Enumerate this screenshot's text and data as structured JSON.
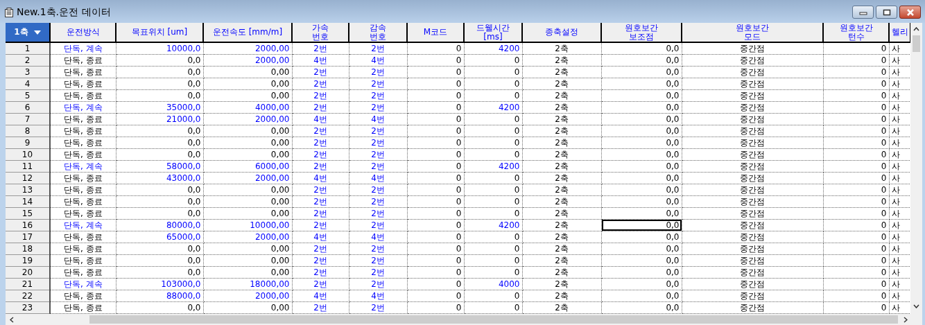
{
  "window": {
    "title": "New.1축.운전 데이터"
  },
  "axis_selector": {
    "value": "1축"
  },
  "columns": [
    "운전방식",
    "목표위치 [um]",
    "운전속도 [mm/m]",
    "가속\n번호",
    "감속\n번호",
    "M코드",
    "드웰시간\n[ms]",
    "종축설정",
    "원호보간\n보조점",
    "원호보간\n모드",
    "원호보간\n턴수",
    "헬리"
  ],
  "rows": [
    {
      "label": "1",
      "values": [
        "단독, 계속",
        "10000,0",
        "2000,00",
        "2번",
        "2번",
        "0",
        "4200",
        "2축",
        "0,0",
        "중간점",
        "0",
        "사"
      ],
      "blue": [
        true,
        true,
        true,
        true,
        true,
        false,
        true,
        false,
        false,
        false,
        false,
        false
      ],
      "selected": [
        false,
        false,
        false,
        false,
        false,
        false,
        false,
        false,
        false,
        false,
        false,
        false
      ]
    },
    {
      "label": "2",
      "values": [
        "단독, 종료",
        "0,0",
        "2000,00",
        "4번",
        "4번",
        "0",
        "0",
        "2축",
        "0,0",
        "중간점",
        "0",
        "사"
      ],
      "blue": [
        false,
        false,
        true,
        true,
        true,
        false,
        false,
        false,
        false,
        false,
        false,
        false
      ],
      "selected": [
        false,
        false,
        false,
        false,
        false,
        false,
        false,
        false,
        false,
        false,
        false,
        false
      ]
    },
    {
      "label": "3",
      "values": [
        "단독, 종료",
        "0,0",
        "0,00",
        "2번",
        "2번",
        "0",
        "0",
        "2축",
        "0,0",
        "중간점",
        "0",
        "사"
      ],
      "blue": [
        false,
        false,
        false,
        true,
        true,
        false,
        false,
        false,
        false,
        false,
        false,
        false
      ],
      "selected": [
        false,
        false,
        false,
        false,
        false,
        false,
        false,
        false,
        false,
        false,
        false,
        false
      ]
    },
    {
      "label": "4",
      "values": [
        "단독, 종료",
        "0,0",
        "0,00",
        "2번",
        "2번",
        "0",
        "0",
        "2축",
        "0,0",
        "중간점",
        "0",
        "사"
      ],
      "blue": [
        false,
        false,
        false,
        true,
        true,
        false,
        false,
        false,
        false,
        false,
        false,
        false
      ],
      "selected": [
        false,
        false,
        false,
        false,
        false,
        false,
        false,
        false,
        false,
        false,
        false,
        false
      ]
    },
    {
      "label": "5",
      "values": [
        "단독, 종료",
        "0,0",
        "0,00",
        "2번",
        "2번",
        "0",
        "0",
        "2축",
        "0,0",
        "중간점",
        "0",
        "사"
      ],
      "blue": [
        false,
        false,
        false,
        true,
        true,
        false,
        false,
        false,
        false,
        false,
        false,
        false
      ],
      "selected": [
        false,
        false,
        false,
        false,
        false,
        false,
        false,
        false,
        false,
        false,
        false,
        false
      ]
    },
    {
      "label": "6",
      "values": [
        "단독, 계속",
        "35000,0",
        "4000,00",
        "2번",
        "2번",
        "0",
        "4200",
        "2축",
        "0,0",
        "중간점",
        "0",
        "사"
      ],
      "blue": [
        true,
        true,
        true,
        true,
        true,
        false,
        true,
        false,
        false,
        false,
        false,
        false
      ],
      "selected": [
        false,
        false,
        false,
        false,
        false,
        false,
        false,
        false,
        false,
        false,
        false,
        false
      ]
    },
    {
      "label": "7",
      "values": [
        "단독, 종료",
        "21000,0",
        "2000,00",
        "4번",
        "4번",
        "0",
        "0",
        "2축",
        "0,0",
        "중간점",
        "0",
        "사"
      ],
      "blue": [
        false,
        true,
        true,
        true,
        true,
        false,
        false,
        false,
        false,
        false,
        false,
        false
      ],
      "selected": [
        false,
        false,
        false,
        false,
        false,
        false,
        false,
        false,
        false,
        false,
        false,
        false
      ]
    },
    {
      "label": "8",
      "values": [
        "단독, 종료",
        "0,0",
        "0,00",
        "2번",
        "2번",
        "0",
        "0",
        "2축",
        "0,0",
        "중간점",
        "0",
        "사"
      ],
      "blue": [
        false,
        false,
        false,
        true,
        true,
        false,
        false,
        false,
        false,
        false,
        false,
        false
      ],
      "selected": [
        false,
        false,
        false,
        false,
        false,
        false,
        false,
        false,
        false,
        false,
        false,
        false
      ]
    },
    {
      "label": "9",
      "values": [
        "단독, 종료",
        "0,0",
        "0,00",
        "2번",
        "2번",
        "0",
        "0",
        "2축",
        "0,0",
        "중간점",
        "0",
        "사"
      ],
      "blue": [
        false,
        false,
        false,
        true,
        true,
        false,
        false,
        false,
        false,
        false,
        false,
        false
      ],
      "selected": [
        false,
        false,
        false,
        false,
        false,
        false,
        false,
        false,
        false,
        false,
        false,
        false
      ]
    },
    {
      "label": "10",
      "values": [
        "단독, 종료",
        "0,0",
        "0,00",
        "2번",
        "2번",
        "0",
        "0",
        "2축",
        "0,0",
        "중간점",
        "0",
        "사"
      ],
      "blue": [
        false,
        false,
        false,
        true,
        true,
        false,
        false,
        false,
        false,
        false,
        false,
        false
      ],
      "selected": [
        false,
        false,
        false,
        false,
        false,
        false,
        false,
        false,
        false,
        false,
        false,
        false
      ]
    },
    {
      "label": "11",
      "values": [
        "단독, 계속",
        "58000,0",
        "6000,00",
        "2번",
        "2번",
        "0",
        "4200",
        "2축",
        "0,0",
        "중간점",
        "0",
        "사"
      ],
      "blue": [
        true,
        true,
        true,
        true,
        true,
        false,
        true,
        false,
        false,
        false,
        false,
        false
      ],
      "selected": [
        false,
        false,
        false,
        false,
        false,
        false,
        false,
        false,
        false,
        false,
        false,
        false
      ]
    },
    {
      "label": "12",
      "values": [
        "단독, 종료",
        "43000,0",
        "2000,00",
        "4번",
        "4번",
        "0",
        "0",
        "2축",
        "0,0",
        "중간점",
        "0",
        "사"
      ],
      "blue": [
        false,
        true,
        true,
        true,
        true,
        false,
        false,
        false,
        false,
        false,
        false,
        false
      ],
      "selected": [
        false,
        false,
        false,
        false,
        false,
        false,
        false,
        false,
        false,
        false,
        false,
        false
      ]
    },
    {
      "label": "13",
      "values": [
        "단독, 종료",
        "0,0",
        "0,00",
        "2번",
        "2번",
        "0",
        "0",
        "2축",
        "0,0",
        "중간점",
        "0",
        "사"
      ],
      "blue": [
        false,
        false,
        false,
        true,
        true,
        false,
        false,
        false,
        false,
        false,
        false,
        false
      ],
      "selected": [
        false,
        false,
        false,
        false,
        false,
        false,
        false,
        false,
        false,
        false,
        false,
        false
      ]
    },
    {
      "label": "14",
      "values": [
        "단독, 종료",
        "0,0",
        "0,00",
        "2번",
        "2번",
        "0",
        "0",
        "2축",
        "0,0",
        "중간점",
        "0",
        "사"
      ],
      "blue": [
        false,
        false,
        false,
        true,
        true,
        false,
        false,
        false,
        false,
        false,
        false,
        false
      ],
      "selected": [
        false,
        false,
        false,
        false,
        false,
        false,
        false,
        false,
        false,
        false,
        false,
        false
      ]
    },
    {
      "label": "15",
      "values": [
        "단독, 종료",
        "0,0",
        "0,00",
        "2번",
        "2번",
        "0",
        "0",
        "2축",
        "0,0",
        "중간점",
        "0",
        "사"
      ],
      "blue": [
        false,
        false,
        false,
        true,
        true,
        false,
        false,
        false,
        false,
        false,
        false,
        false
      ],
      "selected": [
        false,
        false,
        false,
        false,
        false,
        false,
        false,
        false,
        false,
        false,
        false,
        false
      ]
    },
    {
      "label": "16",
      "values": [
        "단독, 계속",
        "80000,0",
        "10000,00",
        "2번",
        "2번",
        "0",
        "4200",
        "2축",
        "0,0",
        "중간점",
        "0",
        "사"
      ],
      "blue": [
        true,
        true,
        true,
        true,
        true,
        false,
        true,
        false,
        false,
        false,
        false,
        false
      ],
      "selected": [
        false,
        false,
        false,
        false,
        false,
        false,
        false,
        false,
        true,
        false,
        false,
        false
      ]
    },
    {
      "label": "17",
      "values": [
        "단독, 종료",
        "65000,0",
        "2000,00",
        "4번",
        "4번",
        "0",
        "0",
        "2축",
        "0,0",
        "중간점",
        "0",
        "사"
      ],
      "blue": [
        false,
        true,
        true,
        true,
        true,
        false,
        false,
        false,
        false,
        false,
        false,
        false
      ],
      "selected": [
        false,
        false,
        false,
        false,
        false,
        false,
        false,
        false,
        false,
        false,
        false,
        false
      ]
    },
    {
      "label": "18",
      "values": [
        "단독, 종료",
        "0,0",
        "0,00",
        "2번",
        "2번",
        "0",
        "0",
        "2축",
        "0,0",
        "중간점",
        "0",
        "사"
      ],
      "blue": [
        false,
        false,
        false,
        true,
        true,
        false,
        false,
        false,
        false,
        false,
        false,
        false
      ],
      "selected": [
        false,
        false,
        false,
        false,
        false,
        false,
        false,
        false,
        false,
        false,
        false,
        false
      ]
    },
    {
      "label": "19",
      "values": [
        "단독, 종료",
        "0,0",
        "0,00",
        "2번",
        "2번",
        "0",
        "0",
        "2축",
        "0,0",
        "중간점",
        "0",
        "사"
      ],
      "blue": [
        false,
        false,
        false,
        true,
        true,
        false,
        false,
        false,
        false,
        false,
        false,
        false
      ],
      "selected": [
        false,
        false,
        false,
        false,
        false,
        false,
        false,
        false,
        false,
        false,
        false,
        false
      ]
    },
    {
      "label": "20",
      "values": [
        "단독, 종료",
        "0,0",
        "0,00",
        "2번",
        "2번",
        "0",
        "0",
        "2축",
        "0,0",
        "중간점",
        "0",
        "사"
      ],
      "blue": [
        false,
        false,
        false,
        true,
        true,
        false,
        false,
        false,
        false,
        false,
        false,
        false
      ],
      "selected": [
        false,
        false,
        false,
        false,
        false,
        false,
        false,
        false,
        false,
        false,
        false,
        false
      ]
    },
    {
      "label": "21",
      "values": [
        "단독, 계속",
        "103000,0",
        "18000,00",
        "2번",
        "2번",
        "0",
        "4000",
        "2축",
        "0,0",
        "중간점",
        "0",
        "사"
      ],
      "blue": [
        true,
        true,
        true,
        true,
        true,
        false,
        true,
        false,
        false,
        false,
        false,
        false
      ],
      "selected": [
        false,
        false,
        false,
        false,
        false,
        false,
        false,
        false,
        false,
        false,
        false,
        false
      ]
    },
    {
      "label": "22",
      "values": [
        "단독, 종료",
        "88000,0",
        "2000,00",
        "4번",
        "4번",
        "0",
        "0",
        "2축",
        "0,0",
        "중간점",
        "0",
        "사"
      ],
      "blue": [
        false,
        true,
        true,
        true,
        true,
        false,
        false,
        false,
        false,
        false,
        false,
        false
      ],
      "selected": [
        false,
        false,
        false,
        false,
        false,
        false,
        false,
        false,
        false,
        false,
        false,
        false
      ]
    },
    {
      "label": "23",
      "values": [
        "단독, 종료",
        "0,0",
        "0,00",
        "2번",
        "2번",
        "0",
        "0",
        "2축",
        "0,0",
        "중간점",
        "0",
        "사"
      ],
      "blue": [
        false,
        false,
        false,
        true,
        true,
        false,
        false,
        false,
        false,
        false,
        false,
        false
      ],
      "selected": [
        false,
        false,
        false,
        false,
        false,
        false,
        false,
        false,
        false,
        false,
        false,
        false
      ]
    }
  ]
}
